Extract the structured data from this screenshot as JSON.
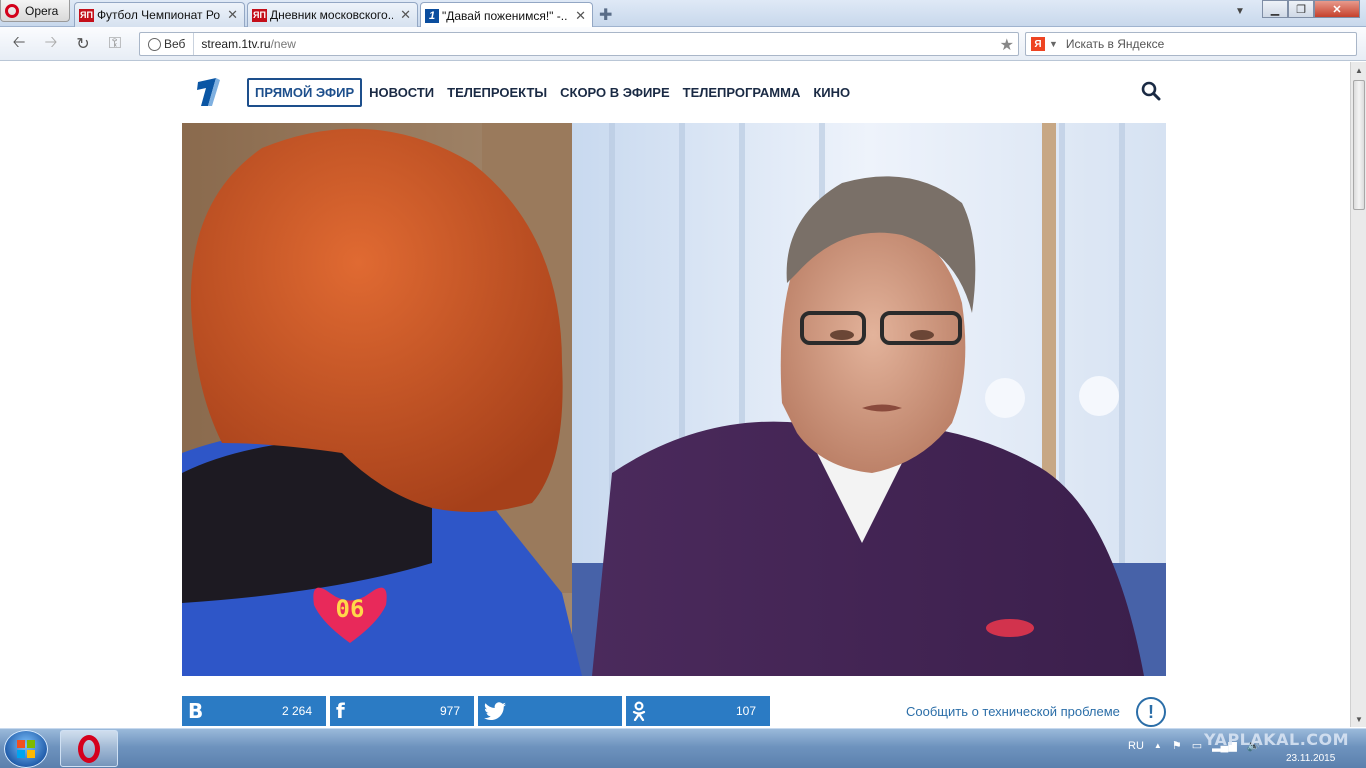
{
  "browser": {
    "menu_label": "Opera",
    "tabs": [
      {
        "label": "Футбол Чемпионат Ро...",
        "favicon": "ЯП"
      },
      {
        "label": "Дневник московского...",
        "favicon": "ЯП"
      },
      {
        "label": "\"Давай поженимся!\" -...",
        "favicon": "1"
      }
    ],
    "address": {
      "scheme_label": "Веб",
      "host": "stream.1tv.ru",
      "path": "/new"
    },
    "search": {
      "engine_badge": "Я",
      "placeholder": "Искать в Яндексе"
    }
  },
  "site": {
    "nav": [
      "ПРЯМОЙ ЭФИР",
      "НОВОСТИ",
      "ТЕЛЕПРОЕКТЫ",
      "СКОРО В ЭФИРЕ",
      "ТЕЛЕПРОГРАММА",
      "КИНО"
    ],
    "video": {
      "heart_counter": "06"
    },
    "share": [
      {
        "network": "vk",
        "icon": "B",
        "count": "2 264"
      },
      {
        "network": "facebook",
        "icon": "f",
        "count": "977"
      },
      {
        "network": "twitter",
        "icon": "🐦",
        "count": ""
      },
      {
        "network": "odnoklassniki",
        "icon": "ok",
        "count": "107"
      }
    ],
    "report_link": "Сообщить о технической проблеме",
    "report_icon": "!"
  },
  "taskbar": {
    "language": "RU",
    "date": "23.11.2015"
  },
  "watermark": "YAPLAKAL.COM",
  "colors": {
    "accent": "#2b7bc4",
    "nav_text": "#1a2a44",
    "live_border": "#1d4f8c",
    "opera_red": "#d5001c"
  }
}
